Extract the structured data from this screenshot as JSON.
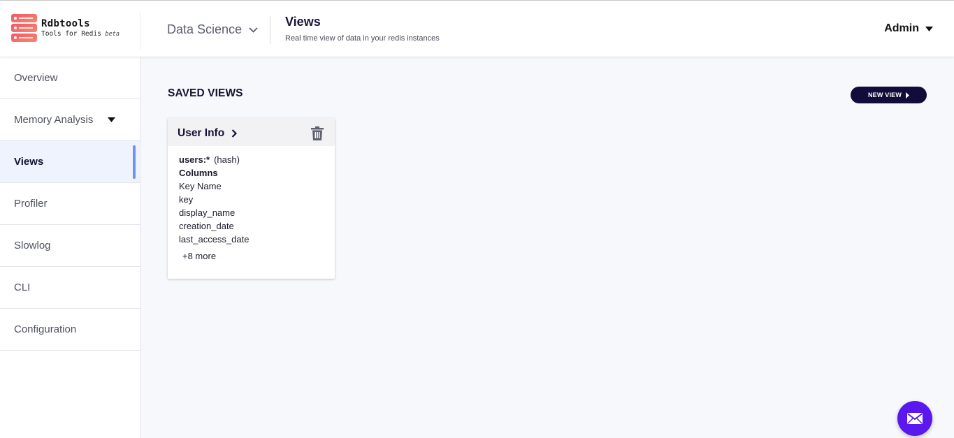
{
  "brand": {
    "name": "Rdbtools",
    "tagline": "Tools for Redis",
    "badge": "beta",
    "logo_colors": [
      "#f2566a",
      "#f58a6c"
    ]
  },
  "header": {
    "instance_name": "Data Science",
    "page_title": "Views",
    "page_subtitle": "Real time view of data in your redis instances",
    "user_name": "Admin"
  },
  "sidebar": {
    "items": [
      {
        "label": "Overview",
        "active": false
      },
      {
        "label": "Memory Analysis",
        "active": false,
        "has_caret": true
      },
      {
        "label": "Views",
        "active": true
      },
      {
        "label": "Profiler",
        "active": false
      },
      {
        "label": "Slowlog",
        "active": false
      },
      {
        "label": "CLI",
        "active": false
      },
      {
        "label": "Configuration",
        "active": false
      }
    ],
    "active_indicator_color": "#6f94ef"
  },
  "main": {
    "section_title": "SAVED VIEWS",
    "new_view_label": "NEW VIEW",
    "cards": [
      {
        "title": "User Info",
        "key_pattern": "users:*",
        "key_type": "(hash)",
        "columns_title": "Columns",
        "columns": [
          "Key Name",
          "key",
          "display_name",
          "creation_date",
          "last_access_date"
        ],
        "more_label": "+8 more"
      }
    ]
  },
  "colors": {
    "accent_dark": "#120c3a",
    "fab": "#5a17ee",
    "background": "#f7f8fc"
  },
  "icons": {
    "chevron_down": "chevron-down-icon",
    "caret_down": "caret-down-icon",
    "chevron_right": "chevron-right-icon",
    "trash": "trash-icon",
    "mail": "mail-icon"
  }
}
